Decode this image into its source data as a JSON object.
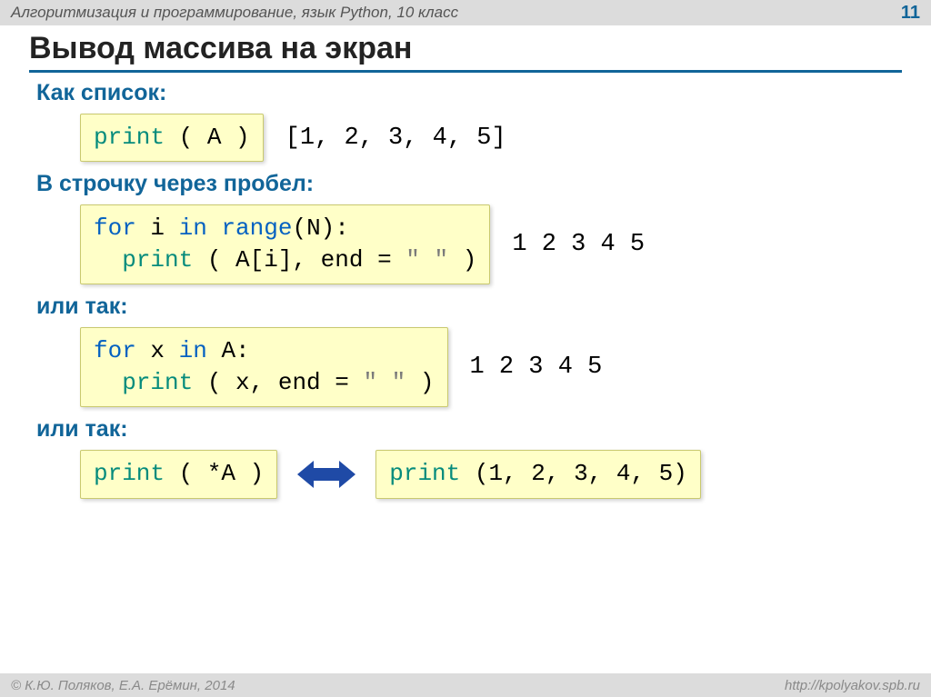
{
  "header": {
    "course": "Алгоритмизация и программирование, язык Python, 10 класс",
    "page": "11"
  },
  "title": "Вывод массива на экран",
  "section1_label": "Как список:",
  "code1": {
    "call": "print",
    "rest": " ( A )"
  },
  "output1": "[1, 2, 3, 4, 5]",
  "section2_label": "В строчку через пробел:",
  "code2": {
    "kw1": "for",
    "v1": " i ",
    "kw2": "in",
    "fn": " range",
    "r2": "(N):\n  ",
    "call": "print",
    "r3": " ( A[i], end = ",
    "str": "\" \"",
    "r4": " )"
  },
  "output2": "1 2 3 4 5",
  "section3_label": "или так:",
  "code3": {
    "kw1": "for",
    "v1": " x ",
    "kw2": "in",
    "r1": " A:\n  ",
    "call": "print",
    "r2": " ( x, end = ",
    "str": "\" \"",
    "r3": " )"
  },
  "output3": "1 2 3 4 5",
  "section4_label": "или так:",
  "code4": {
    "call": "print",
    "rest": " ( *A )"
  },
  "code5": {
    "call": "print",
    "rest": " (1, 2, 3, 4, 5)"
  },
  "footer": {
    "authors": "© К.Ю. Поляков, Е.А. Ерёмин, 2014",
    "url": "http://kpolyakov.spb.ru"
  }
}
